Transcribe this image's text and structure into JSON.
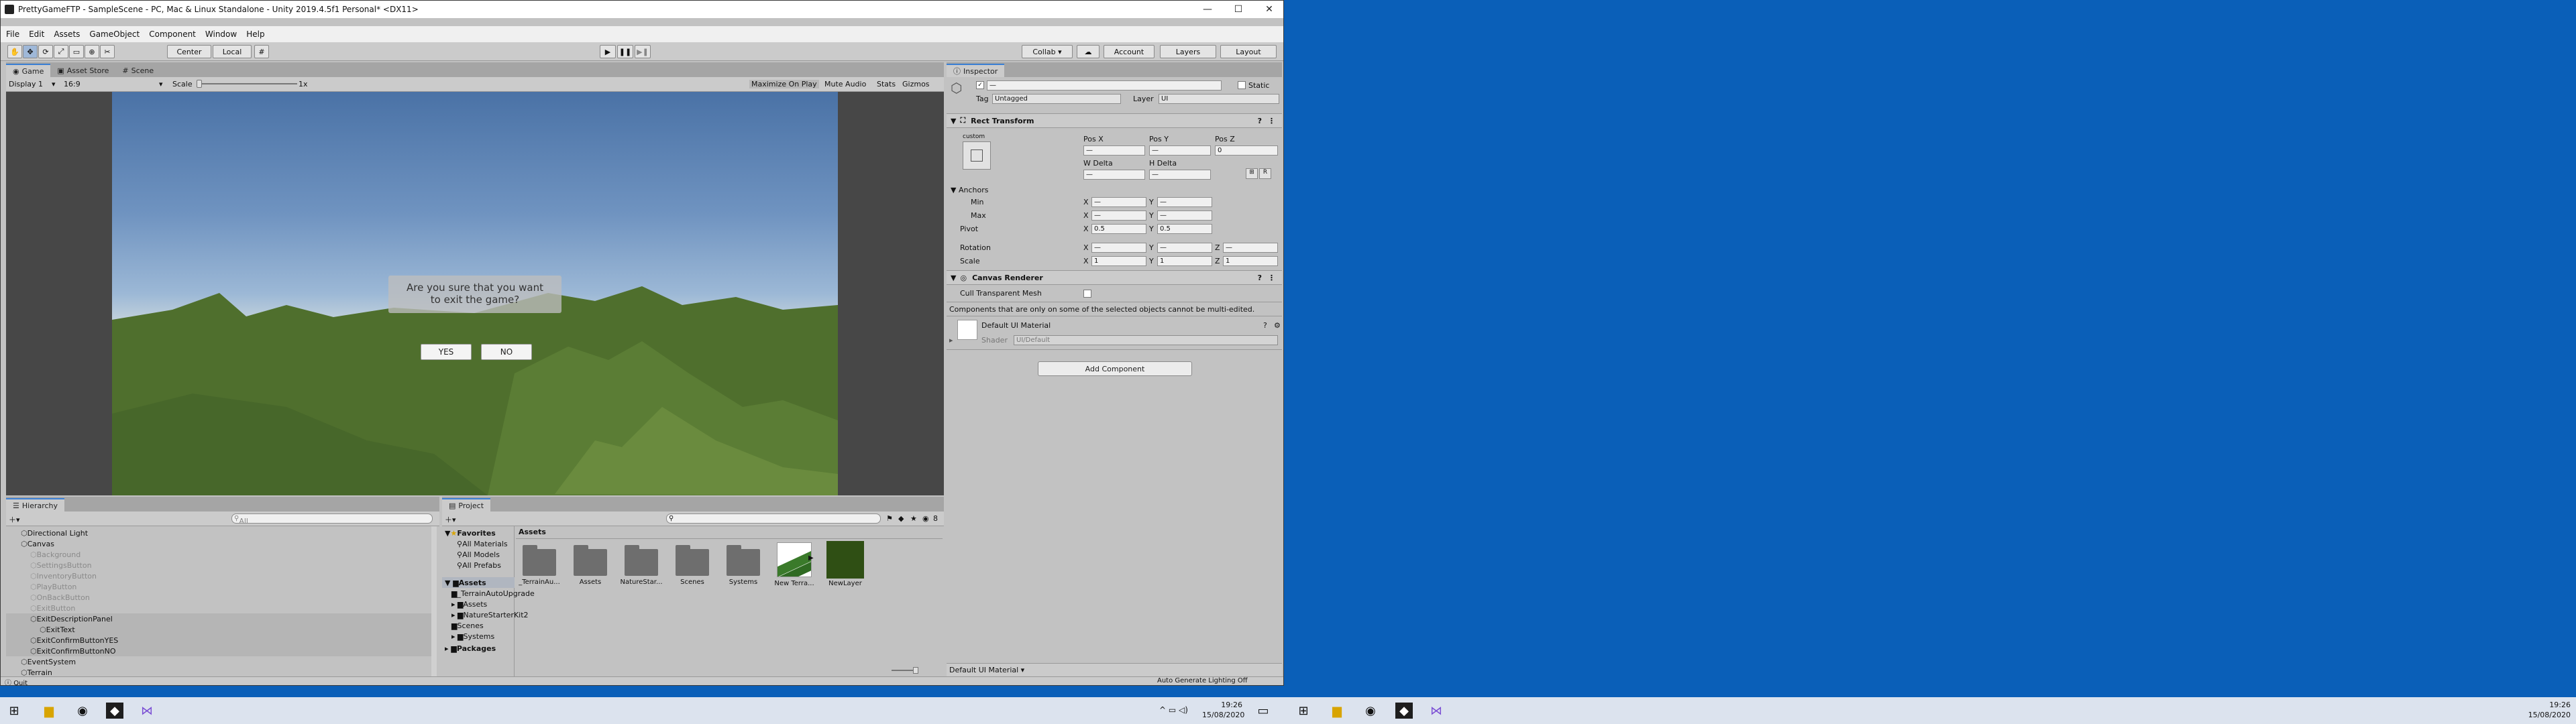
{
  "window": {
    "title": "PrettyGameFTP - SampleScene - PC, Mac & Linux Standalone - Unity 2019.4.5f1 Personal* <DX11>",
    "minimize_glyph": "—",
    "maximize_glyph": "☐",
    "close_glyph": "✕"
  },
  "menu": [
    "File",
    "Edit",
    "Assets",
    "GameObject",
    "Component",
    "Window",
    "Help"
  ],
  "toolbar": {
    "pivot": "Center",
    "space": "Local",
    "collab": "Collab ▾",
    "account": "Account",
    "layers": "Layers",
    "layout": "Layout"
  },
  "game_view": {
    "tabs": [
      "Game",
      "Asset Store",
      "Scene"
    ],
    "display": "Display 1",
    "aspect": "16:9",
    "scale_label": "Scale",
    "scale_value": "1x",
    "maximize_on_play": "Maximize On Play",
    "mute_audio": "Mute Audio",
    "stats": "Stats",
    "gizmos": "Gizmos",
    "dialog_text": "Are you sure that you want to exit the game?",
    "yes": "YES",
    "no": "NO"
  },
  "inspector": {
    "tab": "Inspector",
    "name_value": "—",
    "static_label": "Static",
    "tag_label": "Tag",
    "tag_value": "Untagged",
    "layer_label": "Layer",
    "layer_value": "UI",
    "rect_transform": "Rect Transform",
    "custom": "custom",
    "pos_x": "Pos X",
    "pos_y": "Pos Y",
    "pos_z": "Pos Z",
    "pos_x_val": "—",
    "pos_y_val": "—",
    "pos_z_val": "0",
    "w_delta": "W Delta",
    "h_delta": "H Delta",
    "w_val": "—",
    "h_val": "—",
    "anchors": "Anchors",
    "min": "Min",
    "max": "Max",
    "pivot": "Pivot",
    "rotation": "Rotation",
    "scale": "Scale",
    "x": "X",
    "y": "Y",
    "z": "Z",
    "dash": "—",
    "pivot_x": "0.5",
    "pivot_y": "0.5",
    "scale_x": "1",
    "scale_y": "1",
    "scale_z": "1",
    "canvas_renderer": "Canvas Renderer",
    "cull": "Cull Transparent Mesh",
    "multi_edit_note": "Components that are only on some of the selected objects cannot be multi-edited.",
    "material": "Default UI Material",
    "shader_label": "Shader",
    "shader_value": "UI/Default",
    "add_component": "Add Component",
    "footer_material": "Default UI Material ▾",
    "auto_lighting": "Auto Generate Lighting Off"
  },
  "hierarchy": {
    "tab": "Hierarchy",
    "search_placeholder": "All",
    "items": [
      {
        "label": "Directional Light",
        "indent": 1,
        "dim": false
      },
      {
        "label": "Canvas",
        "indent": 1,
        "dim": false
      },
      {
        "label": "Background",
        "indent": 2,
        "dim": true
      },
      {
        "label": "SettingsButton",
        "indent": 2,
        "dim": true
      },
      {
        "label": "InventoryButton",
        "indent": 2,
        "dim": true
      },
      {
        "label": "PlayButton",
        "indent": 2,
        "dim": true
      },
      {
        "label": "OnBackButton",
        "indent": 2,
        "dim": true
      },
      {
        "label": "ExitButton",
        "indent": 2,
        "dim": true
      },
      {
        "label": "ExitDescriptionPanel",
        "indent": 2,
        "dim": false
      },
      {
        "label": "ExitText",
        "indent": 3,
        "dim": false
      },
      {
        "label": "ExitConfirmButtonYES",
        "indent": 2,
        "dim": false
      },
      {
        "label": "ExitConfirmButtonNO",
        "indent": 2,
        "dim": false
      },
      {
        "label": "EventSystem",
        "indent": 1,
        "dim": false
      },
      {
        "label": "Terrain",
        "indent": 1,
        "dim": false
      }
    ]
  },
  "project": {
    "tab": "Project",
    "favorites": "Favorites",
    "fav_items": [
      "All Materials",
      "All Models",
      "All Prefabs"
    ],
    "assets": "Assets",
    "asset_tree": [
      "_TerrainAutoUpgrade",
      "Assets",
      "NatureStarterKit2",
      "Scenes",
      "Systems"
    ],
    "packages": "Packages",
    "breadcrumb": "Assets",
    "tiles": [
      "_TerrainAu...",
      "Assets",
      "NatureStar...",
      "Scenes",
      "Systems",
      "New Terra...",
      "NewLayer"
    ],
    "count": "8"
  },
  "status": {
    "quit": "Quit"
  },
  "taskbar": {
    "time": "19:26",
    "date": "15/08/2020"
  },
  "colors": {
    "accent": "#3a7fd4",
    "desktop": "#0a5fb8",
    "editor_bg": "#c2c2c2"
  }
}
